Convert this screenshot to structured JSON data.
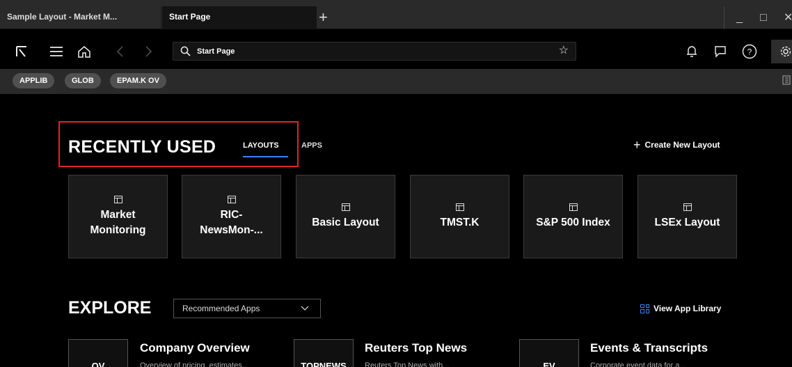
{
  "tabs": [
    {
      "label": "Sample Layout - Market M..."
    },
    {
      "label": "Start Page"
    }
  ],
  "new_tab_label": "+",
  "window_controls": {
    "minimize": "_",
    "maximize": "□",
    "close": "✕"
  },
  "toolbar": {
    "search_value": "Start Page"
  },
  "chips": [
    "APPLIB",
    "GLOB",
    "EPAM.K OV"
  ],
  "recent": {
    "title": "RECENTLY USED",
    "tab_layouts": "LAYOUTS",
    "tab_apps": "APPS",
    "create_label": "Create New Layout",
    "cards": [
      {
        "title": "Market Monitoring"
      },
      {
        "title": "RIC-NewsMon-..."
      },
      {
        "title": "Basic Layout"
      },
      {
        "title": "TMST.K"
      },
      {
        "title": "S&P 500 Index"
      },
      {
        "title": "LSEx Layout"
      }
    ]
  },
  "explore": {
    "title": "EXPLORE",
    "dropdown_value": "Recommended Apps",
    "view_library": "View App Library",
    "apps": [
      {
        "code": "OV",
        "title": "Company Overview",
        "desc": "Overview of pricing, estimates..."
      },
      {
        "code": "TOPNEWS",
        "title": "Reuters Top News",
        "desc": "Reuters Top News with..."
      },
      {
        "code": "EV",
        "title": "Events & Transcripts",
        "desc": "Corporate event data for a..."
      }
    ]
  },
  "colors": {
    "accent": "#3b82f6",
    "highlight": "#e0232a",
    "background": "#000000"
  }
}
